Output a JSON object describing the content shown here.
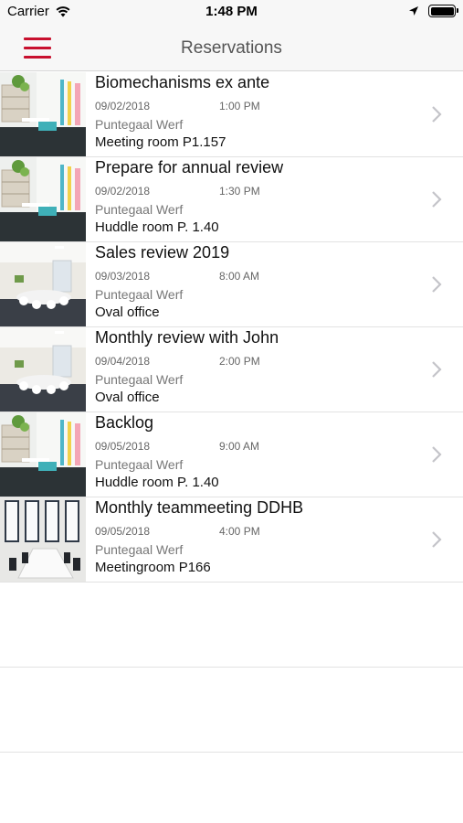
{
  "status_bar": {
    "carrier": "Carrier",
    "time": "1:48 PM"
  },
  "nav": {
    "title": "Reservations"
  },
  "reservations": [
    {
      "title": "Biomechanisms ex ante",
      "date": "09/02/2018",
      "time": "1:00 PM",
      "location": "Puntegaal Werf",
      "room": "Meeting room P1.157",
      "image": "office-plants"
    },
    {
      "title": "Prepare for annual review",
      "date": "09/02/2018",
      "time": "1:30 PM",
      "location": "Puntegaal Werf",
      "room": "Huddle room P. 1.40",
      "image": "office-plants"
    },
    {
      "title": "Sales review 2019",
      "date": "09/03/2018",
      "time": "8:00 AM",
      "location": "Puntegaal Werf",
      "room": "Oval office",
      "image": "oval-office"
    },
    {
      "title": "Monthly review with John",
      "date": "09/04/2018",
      "time": "2:00 PM",
      "location": "Puntegaal Werf",
      "room": "Oval office",
      "image": "oval-office"
    },
    {
      "title": "Backlog",
      "date": "09/05/2018",
      "time": "9:00 AM",
      "location": "Puntegaal Werf",
      "room": "Huddle room P. 1.40",
      "image": "office-plants"
    },
    {
      "title": "Monthly teammeeting DDHB",
      "date": "09/05/2018",
      "time": "4:00 PM",
      "location": "Puntegaal Werf",
      "room": "Meetingroom P166",
      "image": "conference-room"
    }
  ],
  "colors": {
    "accent": "#c8102e",
    "nav_bg": "#f7f7f7"
  }
}
